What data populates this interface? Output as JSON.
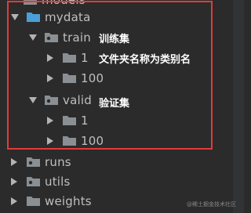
{
  "tree": {
    "top_cut_label": "models",
    "mydata": {
      "label": "mydata",
      "expanded": true
    },
    "train": {
      "label": "train",
      "expanded": true,
      "annotation": "训练集"
    },
    "train_1": {
      "label": "1",
      "annotation": "文件夹名称为类别名"
    },
    "train_100": {
      "label": "100"
    },
    "valid": {
      "label": "valid",
      "expanded": true,
      "annotation": "验证集"
    },
    "valid_1": {
      "label": "1"
    },
    "valid_100": {
      "label": "100"
    },
    "runs": {
      "label": "runs"
    },
    "utils": {
      "label": "utils"
    },
    "weights": {
      "label": "weights"
    }
  },
  "colors": {
    "background": "#2b2b2b",
    "highlight_box": "#e23b3b",
    "folder_module": "#4a9fd8",
    "folder_plain": "#8a8f94",
    "text": "#bfbfbf"
  },
  "watermark": "@稀土掘金技术社区"
}
